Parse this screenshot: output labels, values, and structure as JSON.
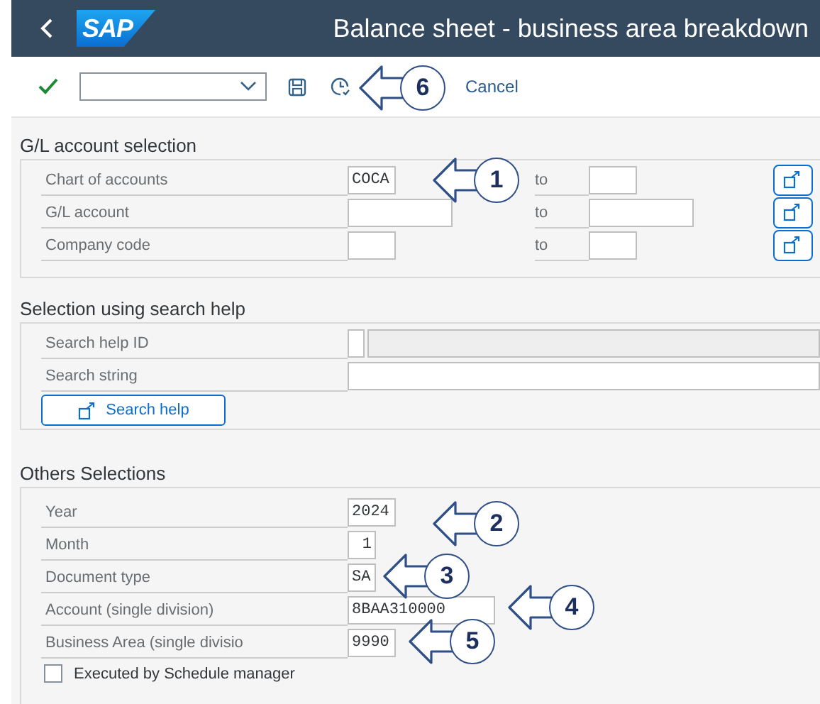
{
  "header": {
    "logo": "SAP",
    "title": "Balance sheet - business area breakdown"
  },
  "toolbar": {
    "cancel": "Cancel"
  },
  "gl_section": {
    "title": "G/L account selection",
    "rows": [
      {
        "label": "Chart of accounts",
        "value": "COCA",
        "to_label": "to",
        "to_value": ""
      },
      {
        "label": "G/L account",
        "value": "",
        "to_label": "to",
        "to_value": ""
      },
      {
        "label": "Company code",
        "value": "",
        "to_label": "to",
        "to_value": ""
      }
    ]
  },
  "search_section": {
    "title": "Selection using search help",
    "rows": [
      {
        "kind": "split",
        "label": "Search help ID"
      },
      {
        "kind": "text",
        "label": "Search string"
      }
    ],
    "button": "Search help"
  },
  "others_section": {
    "title": "Others Selections",
    "rows": [
      {
        "label": "Year",
        "value": "2024"
      },
      {
        "label": "Month",
        "value": "1"
      },
      {
        "label": "Document type",
        "value": "SA"
      },
      {
        "label": "Account (single division)",
        "value": "8BAA310000"
      },
      {
        "label": "Business Area  (single divisio",
        "value": "9990"
      }
    ],
    "checkbox": {
      "label": "Executed by Schedule manager",
      "checked": false
    }
  },
  "callouts": [
    {
      "number": "6"
    },
    {
      "number": "1"
    },
    {
      "number": "2"
    },
    {
      "number": "3"
    },
    {
      "number": "4"
    },
    {
      "number": "5"
    }
  ]
}
